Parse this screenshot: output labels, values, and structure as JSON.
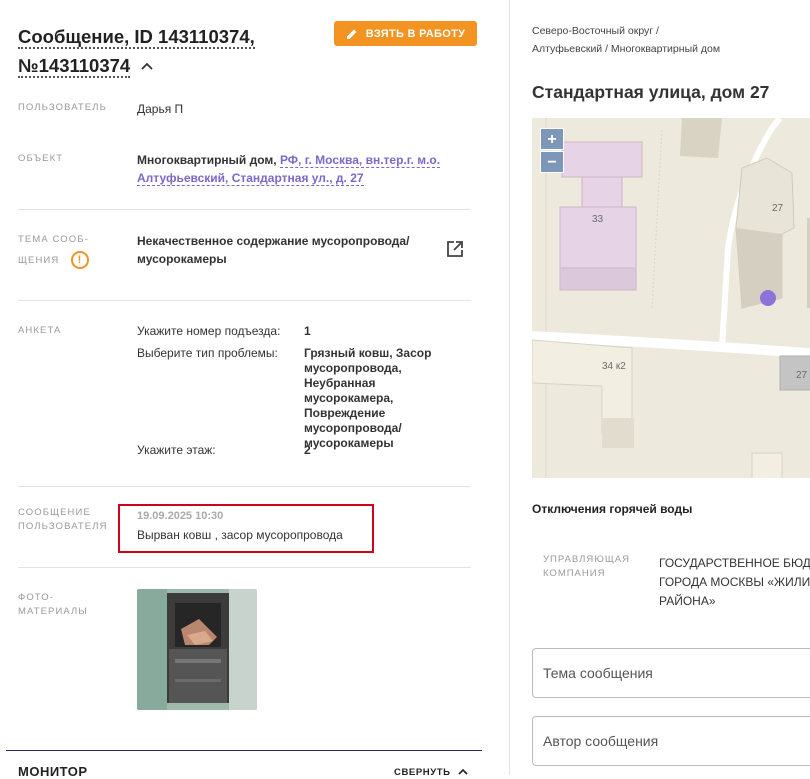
{
  "header": {
    "title_line1": "Сообщение, ID 143110374,",
    "title_line2": "№143110374",
    "take_button": "ВЗЯТЬ В РАБОТУ"
  },
  "details": {
    "user_label": "ПОЛЬЗОВАТЕЛЬ",
    "user_value": "Дарья П",
    "object_label": "ОБЪЕКТ",
    "object_type": "Многоквартирный дом,",
    "object_link_1": "РФ, г. Москва, вн.тер.г. м.о.",
    "object_link_2": "Алтуфьевский, Стандартная ул., д. 27",
    "topic_label_1": "ТЕМА СООБ-",
    "topic_label_2": "ЩЕНИЯ",
    "topic_value_1": "Некачественное содержание мусоропровода/",
    "topic_value_2": "мусорокамеры",
    "form_label": "АНКЕТА",
    "form": [
      {
        "q": "Укажите номер подъезда:",
        "a": "1"
      },
      {
        "q": "Выберите тип проблемы:",
        "a_lines": [
          "Грязный ковш, Засор",
          "мусоропровода, Неубранная",
          "мусорокамера,",
          "Повреждение",
          "мусоропровода/",
          "мусорокамеры"
        ]
      },
      {
        "q": "Укажите этаж:",
        "a": "2"
      }
    ],
    "message_label_1": "СООБЩЕНИЕ",
    "message_label_2": "ПОЛЬЗОВАТЕЛЯ",
    "message_date": "19.09.2025 10:30",
    "message_text": "Вырван ковш , засор мусоропровода",
    "photo_label_1": "ФОТО-",
    "photo_label_2": "МАТЕРИАЛЫ"
  },
  "footer": {
    "monitor": "МОНИТОР",
    "collapse": "СВЕРНУТЬ"
  },
  "right": {
    "breadcrumb_1": "Северо-Восточный округ /",
    "breadcrumb_2": "Алтуфьевский / Многоквартирный дом",
    "address": "Стандартная улица, дом 27",
    "map": {
      "zoom_in": "+",
      "zoom_out": "−",
      "labels": [
        "33",
        "27",
        "34 к2",
        "27"
      ]
    },
    "hot_water": "Отключения горячей воды",
    "mc_label_1": "УПРАВЛЯЮЩАЯ",
    "mc_label_2": "КОМПАНИЯ",
    "mc_lines": [
      "ГОСУДАРСТВЕННОЕ БЮДЖ",
      "ГОРОДА МОСКВЫ «ЖИЛИ",
      "РАЙОНА»"
    ],
    "field_topic": "Тема сообщения",
    "field_author": "Автор сообщения"
  },
  "colors": {
    "accent_orange": "#f39321",
    "link_purple": "#7b68c9",
    "highlight_red": "#d0021b",
    "map_building": "#e6d3e6",
    "map_marker": "#8c72d9"
  }
}
